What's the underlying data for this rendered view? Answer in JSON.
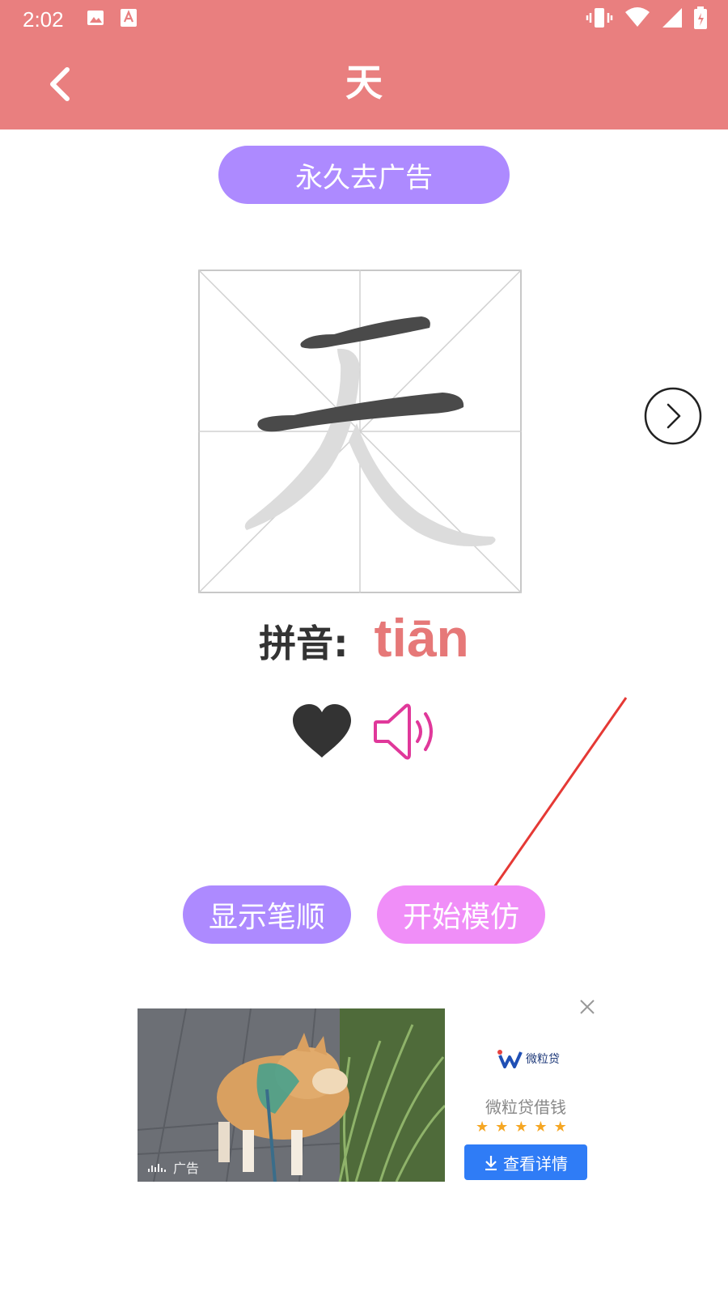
{
  "status_bar": {
    "time": "2:02",
    "left_icons": [
      "image-icon",
      "text-a-icon"
    ],
    "right_icons": [
      "vibrate-icon",
      "wifi-icon",
      "signal-icon",
      "battery-icon"
    ]
  },
  "app_bar": {
    "title": "天",
    "back_icon": "chevron-left-icon",
    "background": "#e97f7f"
  },
  "remove_ads_label": "永久去广告",
  "character": {
    "char": "天",
    "highlighted_strokes": 2,
    "total_strokes": 4
  },
  "pinyin": {
    "label": "拼音:",
    "value": "tiān"
  },
  "icons": {
    "favorite": "heart-icon",
    "sound": "speaker-icon",
    "next": "chevron-right-circle-icon"
  },
  "buttons": {
    "show_stroke_order": "显示笔顺",
    "start_imitate": "开始模仿"
  },
  "ad": {
    "label": "广告",
    "brand_logo_text": "微粒贷",
    "brand_name": "微粒贷借钱",
    "rating": 5,
    "cta": "查看详情"
  },
  "colors": {
    "primary": "#e97f7f",
    "purple_button": "#ad8aff",
    "pink_button": "#f08ef8",
    "pinyin_text": "#e67878",
    "cta_blue": "#2f7cf6"
  }
}
